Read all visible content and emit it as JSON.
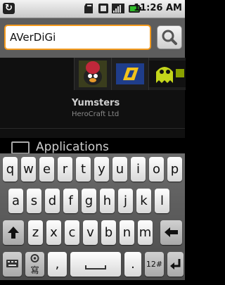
{
  "status_bar": {
    "sync_icon": "sync-icon",
    "time": "11:26 AM",
    "battery_color": "#2fbe29"
  },
  "search": {
    "value": "AVerDiGi"
  },
  "result": {
    "name": "Yumsters",
    "developer": "HeroCraft Ltd"
  },
  "section": {
    "label": "Applications"
  },
  "keyboard": {
    "row1": [
      "q",
      "w",
      "e",
      "r",
      "t",
      "y",
      "u",
      "i",
      "o",
      "p"
    ],
    "row2": [
      "a",
      "s",
      "d",
      "f",
      "g",
      "h",
      "j",
      "k",
      "l"
    ],
    "row3": [
      "z",
      "x",
      "c",
      "v",
      "b",
      "n",
      "m"
    ],
    "comma": ",",
    "period": ".",
    "numbers": "12#",
    "settings": "寫"
  }
}
